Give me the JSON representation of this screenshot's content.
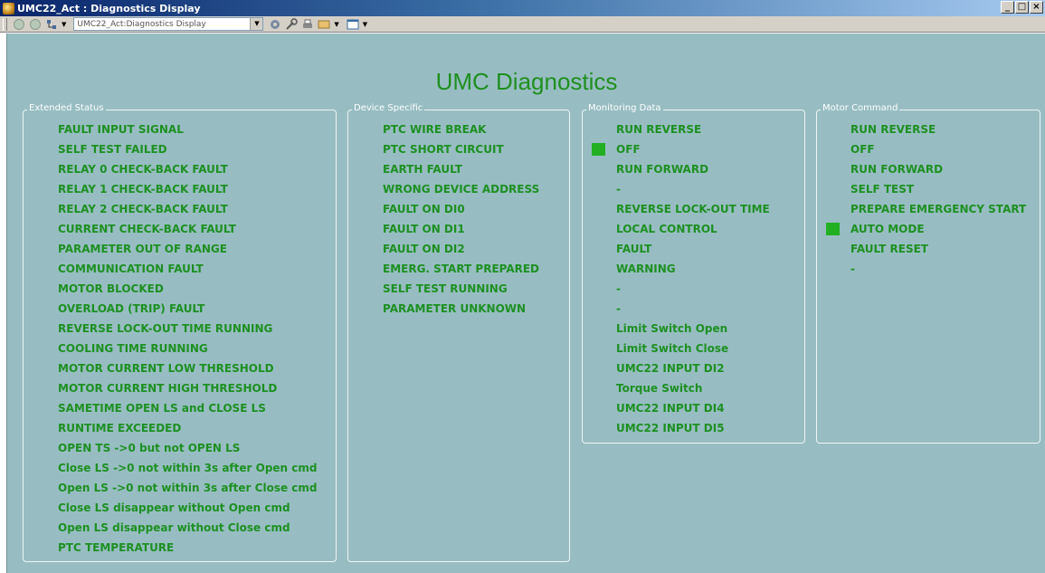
{
  "window": {
    "title": "UMC22_Act : Diagnostics Display",
    "controls": [
      "_",
      "□",
      "×"
    ]
  },
  "toolbar": {
    "combo_value": "UMC22_Act:Diagnostics Display"
  },
  "app_title": "UMC Diagnostics",
  "panels": {
    "extended_status": {
      "title": "Extended Status",
      "items": [
        "FAULT INPUT SIGNAL",
        "SELF TEST FAILED",
        "RELAY 0 CHECK-BACK FAULT",
        "RELAY 1 CHECK-BACK FAULT",
        "RELAY 2 CHECK-BACK FAULT",
        "CURRENT CHECK-BACK FAULT",
        "PARAMETER OUT OF RANGE",
        "COMMUNICATION FAULT",
        "MOTOR BLOCKED",
        "OVERLOAD (TRIP) FAULT",
        "REVERSE LOCK-OUT TIME RUNNING",
        "COOLING TIME RUNNING",
        "MOTOR CURRENT LOW THRESHOLD",
        "MOTOR CURRENT HIGH THRESHOLD",
        "SAMETIME OPEN LS and CLOSE LS",
        "RUNTIME EXCEEDED",
        "OPEN TS ->0 but not OPEN LS",
        "Close LS ->0 not within 3s after Open cmd",
        "Open LS ->0 not within 3s after Close cmd",
        "Close LS disappear without Open cmd",
        "Open LS disappear without Close cmd",
        "PTC TEMPERATURE"
      ]
    },
    "device_specific": {
      "title": "Device Specific",
      "items": [
        "PTC WIRE BREAK",
        "PTC SHORT CIRCUIT",
        "EARTH FAULT",
        "WRONG DEVICE ADDRESS",
        "FAULT ON DI0",
        "FAULT ON DI1",
        "FAULT ON DI2",
        "EMERG. START PREPARED",
        "SELF TEST RUNNING",
        "PARAMETER UNKNOWN"
      ]
    },
    "monitoring_data": {
      "title": "Monitoring Data",
      "items": [
        "RUN REVERSE",
        "OFF",
        "RUN FORWARD",
        "-",
        "REVERSE LOCK-OUT TIME",
        "LOCAL CONTROL",
        "FAULT",
        "WARNING",
        "-",
        "-",
        "Limit Switch Open",
        "Limit Switch Close",
        "UMC22 INPUT DI2",
        "Torque Switch",
        "UMC22 INPUT DI4",
        "UMC22 INPUT DI5"
      ],
      "active_item": "OFF"
    },
    "motor_command": {
      "title": "Motor Command",
      "items": [
        "RUN REVERSE",
        "OFF",
        "RUN FORWARD",
        "SELF TEST",
        "PREPARE EMERGENCY START",
        "AUTO MODE",
        "FAULT RESET",
        "-"
      ],
      "active_item": "AUTO MODE"
    }
  },
  "colors": {
    "background": "#97bdc2",
    "text_green": "#1d9022",
    "indicator_green": "#22b022"
  }
}
